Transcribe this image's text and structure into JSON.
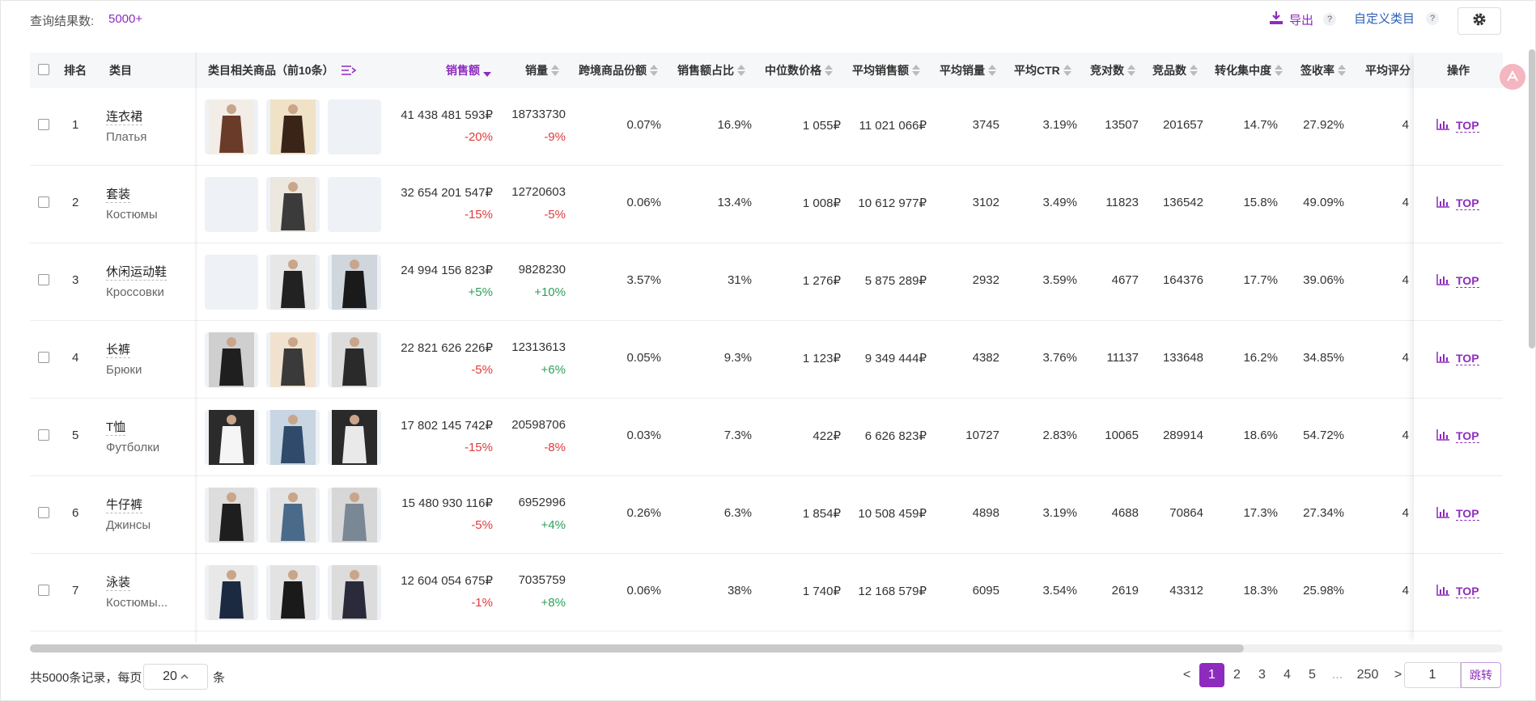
{
  "header": {
    "result_label": "查询结果数:",
    "result_count": "5000+",
    "export_label": "导出",
    "help_mark": "?",
    "custom_label": "自定义类目",
    "icons": {
      "export": "download-icon",
      "settings": "gear-icon",
      "help": "help-icon"
    }
  },
  "columns": {
    "rank": "排名",
    "category": "类目",
    "products": "类目相关商品（前10条）",
    "sales": "销售额",
    "volume": "销量",
    "crossborder": "跨境商品份额",
    "sales_share": "销售额占比",
    "median_price": "中位数价格",
    "avg_sales": "平均销售额",
    "avg_volume": "平均销量",
    "avg_ctr": "平均CTR",
    "competitors": "竞对数",
    "competing_items": "竞品数",
    "conversion": "转化集中度",
    "receipt": "签收率",
    "rating": "平均评分",
    "actions": "操作"
  },
  "rows": [
    {
      "rank": "1",
      "cn": "连衣裙",
      "ru": "Платья",
      "sales": "41 438 481 593₽",
      "sales_chg": "-20%",
      "sales_dir": "neg",
      "volume": "18733730",
      "volume_chg": "-9%",
      "volume_dir": "neg",
      "crossborder": "0.07%",
      "share": "16.9%",
      "median": "1 055₽",
      "avg_sales": "11 021 066₽",
      "avg_volume": "3745",
      "ctr": "3.19%",
      "competitors": "13507",
      "items": "201657",
      "conversion": "14.7%",
      "receipt": "27.92%",
      "rating": "4",
      "op": "TOP"
    },
    {
      "rank": "2",
      "cn": "套装",
      "ru": "Костюмы",
      "sales": "32 654 201 547₽",
      "sales_chg": "-15%",
      "sales_dir": "neg",
      "volume": "12720603",
      "volume_chg": "-5%",
      "volume_dir": "neg",
      "crossborder": "0.06%",
      "share": "13.4%",
      "median": "1 008₽",
      "avg_sales": "10 612 977₽",
      "avg_volume": "3102",
      "ctr": "3.49%",
      "competitors": "11823",
      "items": "136542",
      "conversion": "15.8%",
      "receipt": "49.09%",
      "rating": "4",
      "op": "TOP"
    },
    {
      "rank": "3",
      "cn": "休闲运动鞋",
      "ru": "Кроссовки",
      "sales": "24 994 156 823₽",
      "sales_chg": "+5%",
      "sales_dir": "pos",
      "volume": "9828230",
      "volume_chg": "+10%",
      "volume_dir": "pos",
      "crossborder": "3.57%",
      "share": "31%",
      "median": "1 276₽",
      "avg_sales": "5 875 289₽",
      "avg_volume": "2932",
      "ctr": "3.59%",
      "competitors": "4677",
      "items": "164376",
      "conversion": "17.7%",
      "receipt": "39.06%",
      "rating": "4",
      "op": "TOP"
    },
    {
      "rank": "4",
      "cn": "长裤",
      "ru": "Брюки",
      "sales": "22 821 626 226₽",
      "sales_chg": "-5%",
      "sales_dir": "neg",
      "volume": "12313613",
      "volume_chg": "+6%",
      "volume_dir": "pos",
      "crossborder": "0.05%",
      "share": "9.3%",
      "median": "1 123₽",
      "avg_sales": "9 349 444₽",
      "avg_volume": "4382",
      "ctr": "3.76%",
      "competitors": "11137",
      "items": "133648",
      "conversion": "16.2%",
      "receipt": "34.85%",
      "rating": "4",
      "op": "TOP"
    },
    {
      "rank": "5",
      "cn": "T恤",
      "ru": "Футболки",
      "sales": "17 802 145 742₽",
      "sales_chg": "-15%",
      "sales_dir": "neg",
      "volume": "20598706",
      "volume_chg": "-8%",
      "volume_dir": "neg",
      "crossborder": "0.03%",
      "share": "7.3%",
      "median": "422₽",
      "avg_sales": "6 626 823₽",
      "avg_volume": "10727",
      "ctr": "2.83%",
      "competitors": "10065",
      "items": "289914",
      "conversion": "18.6%",
      "receipt": "54.72%",
      "rating": "4",
      "op": "TOP"
    },
    {
      "rank": "6",
      "cn": "牛仔裤",
      "ru": "Джинсы",
      "sales": "15 480 930 116₽",
      "sales_chg": "-5%",
      "sales_dir": "neg",
      "volume": "6952996",
      "volume_chg": "+4%",
      "volume_dir": "pos",
      "crossborder": "0.26%",
      "share": "6.3%",
      "median": "1 854₽",
      "avg_sales": "10 508 459₽",
      "avg_volume": "4898",
      "ctr": "3.19%",
      "competitors": "4688",
      "items": "70864",
      "conversion": "17.3%",
      "receipt": "27.34%",
      "rating": "4",
      "op": "TOP"
    },
    {
      "rank": "7",
      "cn": "泳装",
      "ru": "Костюмы...",
      "sales": "12 604 054 675₽",
      "sales_chg": "-1%",
      "sales_dir": "neg",
      "volume": "7035759",
      "volume_chg": "+8%",
      "volume_dir": "pos",
      "crossborder": "0.06%",
      "share": "38%",
      "median": "1 740₽",
      "avg_sales": "12 168 579₽",
      "avg_volume": "6095",
      "ctr": "3.54%",
      "competitors": "2619",
      "items": "43312",
      "conversion": "18.3%",
      "receipt": "25.98%",
      "rating": "4",
      "op": "TOP"
    }
  ],
  "footer": {
    "total": "共5000条记录，每页",
    "page_size": "20",
    "unit": "条",
    "prev": "<",
    "next": ">",
    "pages": [
      "1",
      "2",
      "3",
      "4",
      "5",
      "...",
      "250"
    ],
    "current_page": "1",
    "jump_value": "1",
    "jump_label": "跳转"
  },
  "colors": {
    "accent": "#8e2bbf",
    "negative": "#e03a3a",
    "positive": "#2e9e5b",
    "link": "#2c60b8"
  }
}
